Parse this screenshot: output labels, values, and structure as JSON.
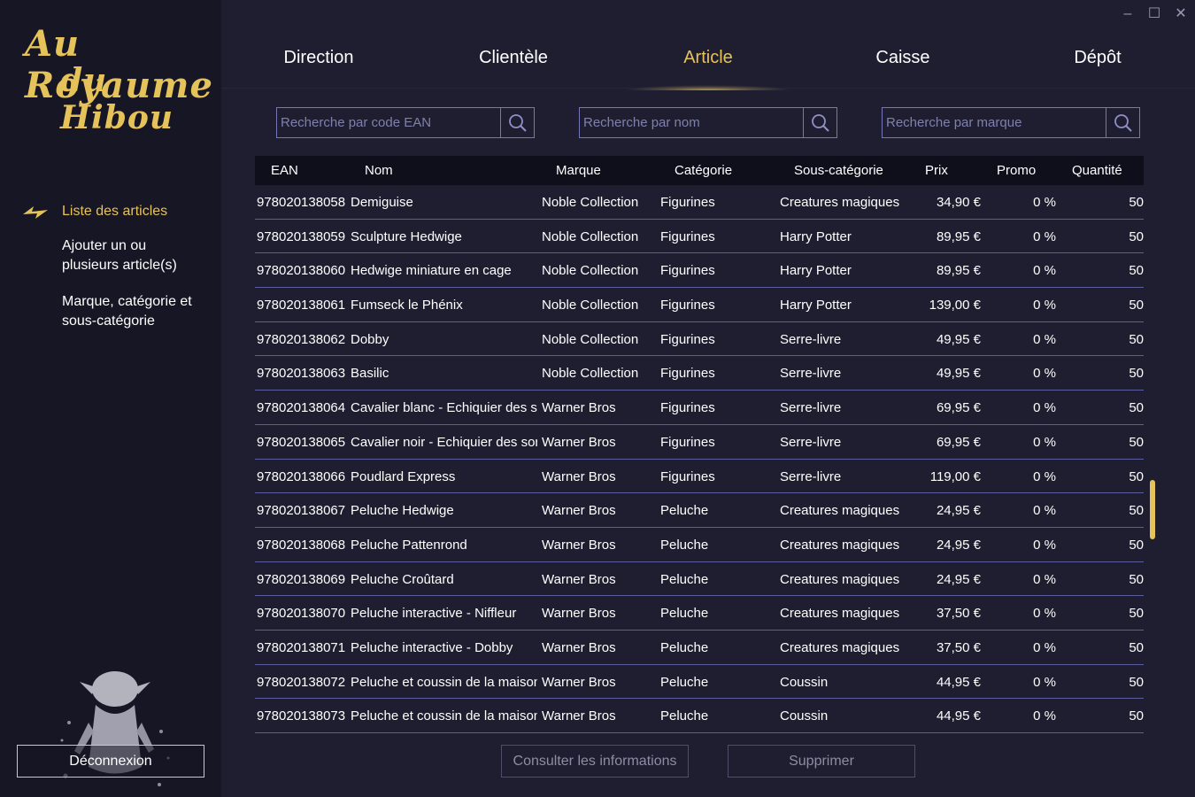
{
  "app": {
    "logo_line1": "Au Royaume",
    "logo_line2": "du Hibou",
    "accent_color": "#e6c25a"
  },
  "window_controls": {
    "minimize": "–",
    "maximize": "☐",
    "close": "✕"
  },
  "nav": {
    "tabs": [
      {
        "label": "Direction"
      },
      {
        "label": "Clientèle"
      },
      {
        "label": "Article"
      },
      {
        "label": "Caisse"
      },
      {
        "label": "Dépôt"
      }
    ],
    "active_tab": "Article"
  },
  "sidebar": {
    "items": [
      {
        "label": "Liste des articles",
        "icon": "lightning-bolt-icon"
      },
      {
        "label": "Ajouter un ou plusieurs article(s)"
      },
      {
        "label": "Marque, catégorie et sous-catégorie"
      }
    ],
    "logout_label": "Déconnexion"
  },
  "search": {
    "ean_placeholder": "Recherche par code EAN",
    "nom_placeholder": "Recherche par nom",
    "marque_placeholder": "Recherche par marque"
  },
  "table": {
    "headers": [
      "EAN",
      "Nom",
      "Marque",
      "Catégorie",
      "Sous-catégorie",
      "Prix",
      "Promo",
      "Quantité"
    ],
    "rows": [
      [
        "978020138058",
        "Demiguise",
        "Noble Collection",
        "Figurines",
        "Creatures magiques",
        "34,90 €",
        "0 %",
        "50"
      ],
      [
        "978020138059",
        "Sculpture Hedwige",
        "Noble Collection",
        "Figurines",
        "Harry Potter",
        "89,95 €",
        "0 %",
        "50"
      ],
      [
        "978020138060",
        "Hedwige miniature en cage",
        "Noble Collection",
        "Figurines",
        "Harry Potter",
        "89,95 €",
        "0 %",
        "50"
      ],
      [
        "978020138061",
        "Fumseck le Phénix",
        "Noble Collection",
        "Figurines",
        "Harry Potter",
        "139,00 €",
        "0 %",
        "50"
      ],
      [
        "978020138062",
        "Dobby",
        "Noble Collection",
        "Figurines",
        "Serre-livre",
        "49,95 €",
        "0 %",
        "50"
      ],
      [
        "978020138063",
        "Basilic",
        "Noble Collection",
        "Figurines",
        "Serre-livre",
        "49,95 €",
        "0 %",
        "50"
      ],
      [
        "978020138064",
        "Cavalier blanc - Echiquier des sc",
        "Warner Bros",
        "Figurines",
        "Serre-livre",
        "69,95 €",
        "0 %",
        "50"
      ],
      [
        "978020138065",
        "Cavalier noir - Echiquier des sor",
        "Warner Bros",
        "Figurines",
        "Serre-livre",
        "69,95 €",
        "0 %",
        "50"
      ],
      [
        "978020138066",
        "Poudlard Express",
        "Warner Bros",
        "Figurines",
        "Serre-livre",
        "119,00 €",
        "0 %",
        "50"
      ],
      [
        "978020138067",
        "Peluche Hedwige",
        "Warner Bros",
        "Peluche",
        "Creatures magiques",
        "24,95 €",
        "0 %",
        "50"
      ],
      [
        "978020138068",
        "Peluche Pattenrond",
        "Warner Bros",
        "Peluche",
        "Creatures magiques",
        "24,95 €",
        "0 %",
        "50"
      ],
      [
        "978020138069",
        "Peluche Croûtard",
        "Warner Bros",
        "Peluche",
        "Creatures magiques",
        "24,95 €",
        "0 %",
        "50"
      ],
      [
        "978020138070",
        "Peluche interactive - Niffleur",
        "Warner Bros",
        "Peluche",
        "Creatures magiques",
        "37,50 €",
        "0 %",
        "50"
      ],
      [
        "978020138071",
        "Peluche interactive - Dobby",
        "Warner Bros",
        "Peluche",
        "Creatures magiques",
        "37,50 €",
        "0 %",
        "50"
      ],
      [
        "978020138072",
        "Peluche et coussin de la maison",
        "Warner Bros",
        "Peluche",
        "Coussin",
        "44,95 €",
        "0 %",
        "50"
      ],
      [
        "978020138073",
        "Peluche et coussin de la maison",
        "Warner Bros",
        "Peluche",
        "Coussin",
        "44,95 €",
        "0 %",
        "50"
      ]
    ]
  },
  "actions": {
    "consult_label": "Consulter les informations",
    "delete_label": "Supprimer"
  }
}
